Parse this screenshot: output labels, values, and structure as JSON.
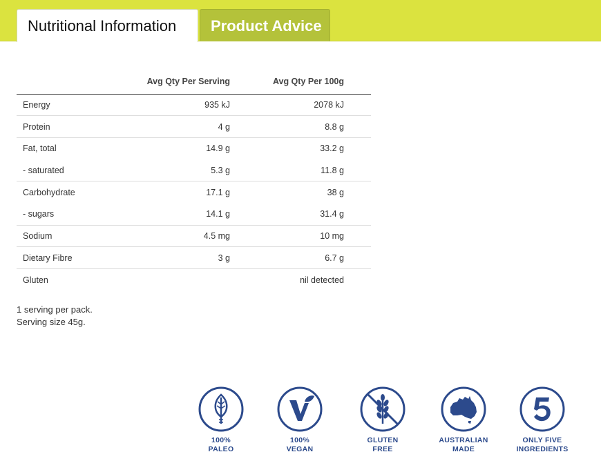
{
  "tabs": [
    {
      "label": "Nutritional Information"
    },
    {
      "label": "Product Advice"
    }
  ],
  "table": {
    "headers": [
      "",
      "Avg Qty Per Serving",
      "Avg Qty Per 100g"
    ],
    "rows": [
      {
        "name": "Energy",
        "serving": "935 kJ",
        "per100": "2078 kJ"
      },
      {
        "name": "Protein",
        "serving": "4 g",
        "per100": "8.8 g"
      },
      {
        "name": "Fat, total",
        "serving": "14.9 g",
        "per100": "33.2 g"
      },
      {
        "name": "- saturated",
        "serving": "5.3 g",
        "per100": "11.8 g"
      },
      {
        "name": "Carbohydrate",
        "serving": "17.1 g",
        "per100": "38 g"
      },
      {
        "name": "- sugars",
        "serving": "14.1 g",
        "per100": "31.4 g"
      },
      {
        "name": "Sodium",
        "serving": "4.5 mg",
        "per100": "10 mg"
      },
      {
        "name": "Dietary Fibre",
        "serving": "3 g",
        "per100": "6.7 g"
      },
      {
        "name": "Gluten",
        "serving": "",
        "per100": "nil detected"
      }
    ]
  },
  "serving_info": {
    "line1": "1 serving per pack.",
    "line2": "Serving size 45g."
  },
  "badges": [
    {
      "line1": "100%",
      "line2": "PALEO",
      "icon": "paleo-leaf-icon"
    },
    {
      "line1": "100%",
      "line2": "VEGAN",
      "icon": "vegan-v-icon"
    },
    {
      "line1": "GLUTEN",
      "line2": "FREE",
      "icon": "gluten-free-wheat-icon"
    },
    {
      "line1": "AUSTRALIAN",
      "line2": "MADE",
      "icon": "australia-map-icon"
    },
    {
      "line1": "ONLY FIVE",
      "line2": "INGREDIENTS",
      "icon": "five-icon"
    }
  ],
  "colors": {
    "tabbar": "#dbe33f",
    "tab_inactive": "#b4c23a",
    "badge_blue": "#2c4a8c"
  }
}
